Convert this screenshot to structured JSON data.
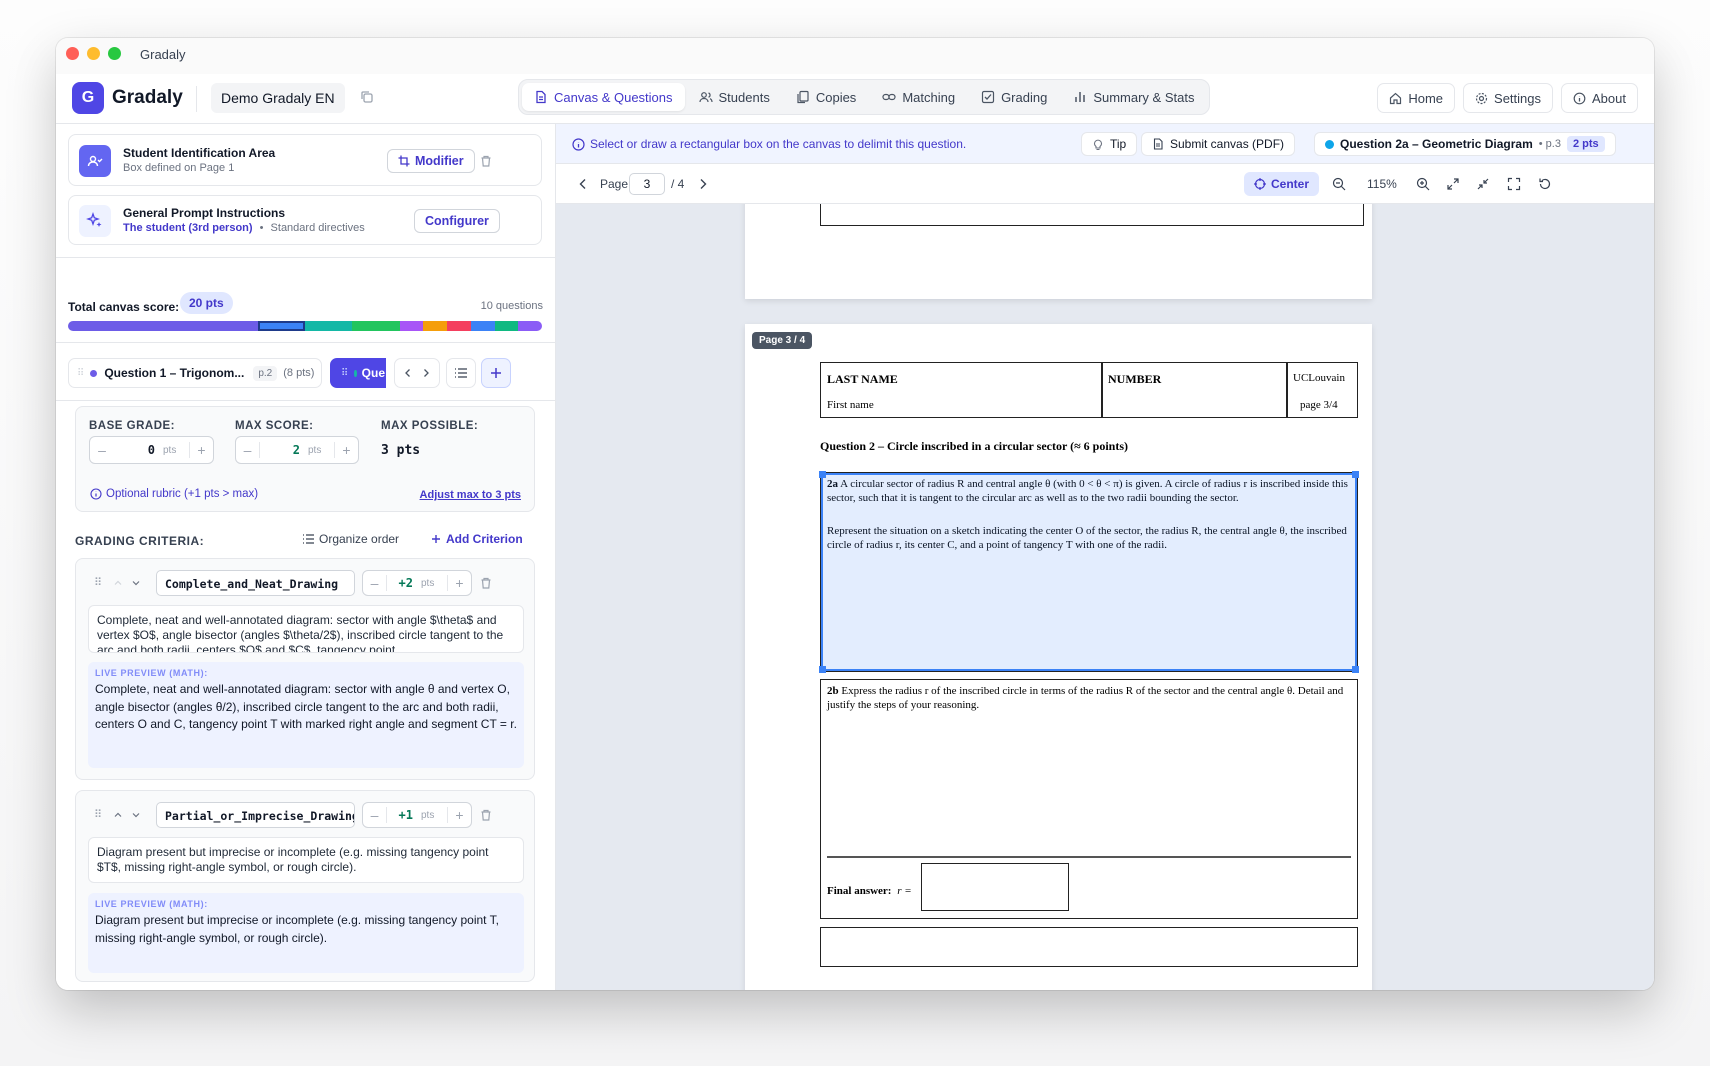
{
  "window": {
    "title": "Gradaly"
  },
  "appbar": {
    "logo_letter": "G",
    "brand": "Gradaly",
    "project": "Demo Gradaly EN"
  },
  "tabs": [
    {
      "label": "Canvas & Questions",
      "icon": "document-icon",
      "active": true
    },
    {
      "label": "Students",
      "icon": "users-icon"
    },
    {
      "label": "Copies",
      "icon": "copies-icon"
    },
    {
      "label": "Matching",
      "icon": "link-icon"
    },
    {
      "label": "Grading",
      "icon": "checkbox-icon"
    },
    {
      "label": "Summary & Stats",
      "icon": "bar-chart-icon"
    }
  ],
  "nav_right": {
    "home": "Home",
    "settings": "Settings",
    "about": "About"
  },
  "left": {
    "id_area": {
      "title": "Student Identification Area",
      "subtitle": "Box defined on Page 1",
      "button": "Modifier"
    },
    "prompt": {
      "title": "General Prompt Instructions",
      "audience": "The student (3rd person)",
      "sep": "•",
      "directives": "Standard directives",
      "button": "Configurer"
    },
    "total_label": "Total canvas score:",
    "total_value": "20 pts",
    "question_count": "10 questions",
    "score_bar_colors": [
      "#6d5ce7",
      "#3b82f6",
      "#14b8a6",
      "#22c55e",
      "#a855f7",
      "#f59e0b",
      "#f43f5e",
      "#3b82f6",
      "#10b981",
      "#8b5cf6"
    ],
    "score_bar_weights": [
      8,
      2,
      2,
      2,
      1,
      1,
      1,
      1,
      1,
      1
    ],
    "question_tab": {
      "title": "Question 1 – Trigonom...",
      "page": "p.2",
      "points": "(8 pts)",
      "active_partial": "Que"
    },
    "grades": {
      "base_label": "BASE GRADE:",
      "base_value": "0",
      "max_label": "MAX SCORE:",
      "max_value": "2",
      "possible_label": "MAX POSSIBLE:",
      "possible_value": "3 pts",
      "unit": "pts",
      "minus": "–",
      "plus": "+",
      "optional_note": "Optional rubric (+1 pts > max)",
      "adjust_link": "Adjust max to 3 pts"
    },
    "criteria_header": {
      "label": "GRADING CRITERIA:",
      "organize": "Organize order",
      "add": "Add Criterion"
    },
    "criteria": [
      {
        "name": "Complete_and_Neat_Drawing",
        "points": "+2",
        "description": "Complete, neat and well-annotated diagram: sector with angle $\\theta$ and vertex $O$, angle bisector (angles $\\theta/2$), inscribed circle tangent to the arc and both radii, centers $O$ and $C$, tangency point",
        "preview_label": "LIVE PREVIEW (MATH):",
        "preview": "Complete, neat and well-annotated diagram: sector with angle θ and vertex O, angle bisector (angles θ/2), inscribed circle tangent to the arc and both radii, centers O and C, tangency point T with marked right angle and segment CT = r."
      },
      {
        "name": "Partial_or_Imprecise_Drawing",
        "points": "+1",
        "description": "Diagram present but imprecise or incomplete (e.g. missing tangency point $T$, missing right-angle symbol, or rough circle).",
        "preview_label": "LIVE PREVIEW (MATH):",
        "preview": "Diagram present but imprecise or incomplete (e.g. missing tangency point T, missing right-angle symbol, or rough circle)."
      }
    ]
  },
  "right": {
    "info": "Select or draw a rectangular box on the canvas to delimit this question.",
    "tip": "Tip",
    "submit": "Submit canvas (PDF)",
    "current_question": {
      "title": "Question 2a – Geometric Diagram",
      "page": "• p.3",
      "points": "2 pts"
    },
    "pager": {
      "label": "Page",
      "current": "3",
      "total": "/ 4"
    },
    "center": "Center",
    "zoom": "115%",
    "pdf": {
      "page_badge": "Page 3 / 4",
      "header": {
        "last_name": "LAST NAME",
        "first_name": "First name",
        "number": "NUMBER",
        "school": "UCLouvain",
        "page": "page 3/4"
      },
      "question_title": "Question 2 – Circle inscribed in a circular sector (≈ 6 points)",
      "q2a_tag": "2a",
      "q2a_p1": "A circular sector of radius R and central angle θ (with 0 < θ < π) is given. A circle of radius r is inscribed inside this sector, such that it is tangent to the circular arc as well as to the two radii bounding the sector.",
      "q2a_p2": "Represent the situation on a sketch indicating the center O of the sector, the radius R, the central angle θ, the inscribed circle of radius r, its center C, and a point of tangency T with one of the radii.",
      "q2b_tag": "2b",
      "q2b_text": "Express the radius r of the inscribed circle in terms of the radius R of the sector and the central angle θ. Detail and justify the steps of your reasoning.",
      "final_label": "Final answer:",
      "final_var": "r ="
    }
  }
}
